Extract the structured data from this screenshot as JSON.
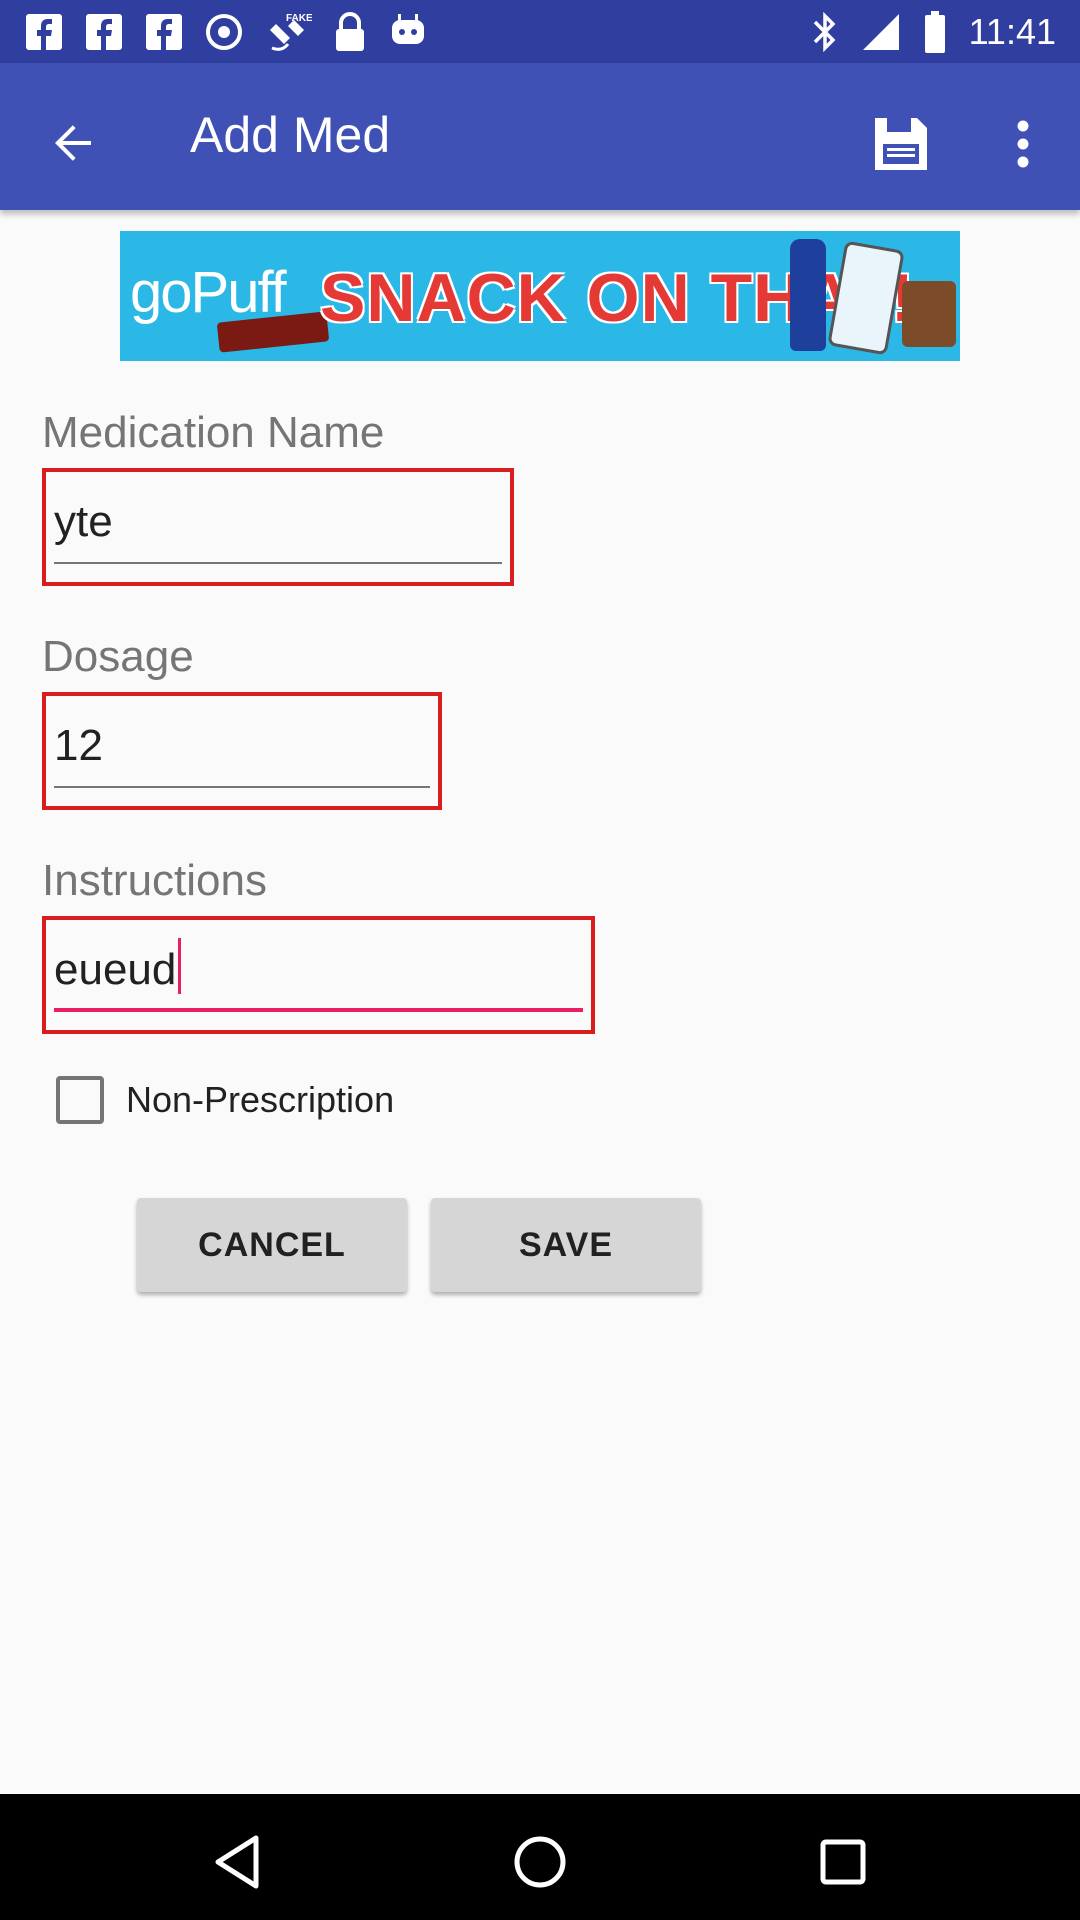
{
  "status_bar": {
    "time": "11:41",
    "icons": [
      "facebook-icon",
      "facebook-icon",
      "facebook-icon",
      "vpn-icon",
      "fake-gps-icon",
      "lock-icon",
      "android-icon",
      "bluetooth-icon",
      "signal-icon",
      "battery-icon"
    ],
    "fake_label": "FAKE"
  },
  "app_bar": {
    "title": "Add Med",
    "colors": {
      "primary": "#3f51b5",
      "primary_dark": "#303f9f"
    }
  },
  "ad": {
    "brand": "goPuff",
    "slogan": "SNACK ON THAT!"
  },
  "form": {
    "medication_name_label": "Medication Name",
    "medication_name_value": "yte",
    "dosage_label": "Dosage",
    "dosage_value": "12",
    "instructions_label": "Instructions",
    "instructions_value": "eueud",
    "non_prescription_label": "Non-Prescription",
    "non_prescription_checked": false
  },
  "buttons": {
    "cancel": "CANCEL",
    "save": "SAVE"
  },
  "nav": {
    "icons": [
      "back-triangle-icon",
      "home-circle-icon",
      "recents-square-icon"
    ]
  }
}
